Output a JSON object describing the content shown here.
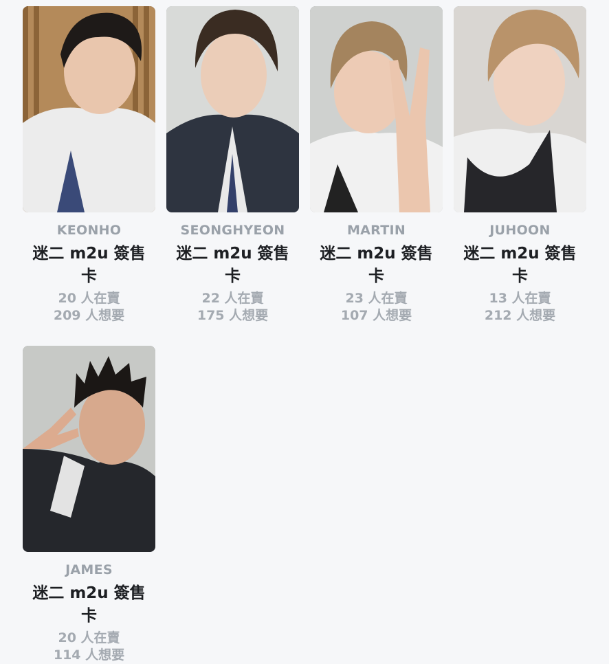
{
  "cards": [
    {
      "member": "KEONHO",
      "title": "迷二 m2u 簽售卡",
      "selling": "20 人在賣",
      "wanting": "209 人想要"
    },
    {
      "member": "SEONGHYEON",
      "title": "迷二 m2u 簽售卡",
      "selling": "22 人在賣",
      "wanting": "175 人想要"
    },
    {
      "member": "MARTIN",
      "title": "迷二 m2u 簽售卡",
      "selling": "23 人在賣",
      "wanting": "107 人想要"
    },
    {
      "member": "JUHOON",
      "title": "迷二 m2u 簽售卡",
      "selling": "13 人在賣",
      "wanting": "212 人想要"
    },
    {
      "member": "JAMES",
      "title": "迷二 m2u 簽售卡",
      "selling": "20 人在賣",
      "wanting": "114 人想要"
    }
  ]
}
